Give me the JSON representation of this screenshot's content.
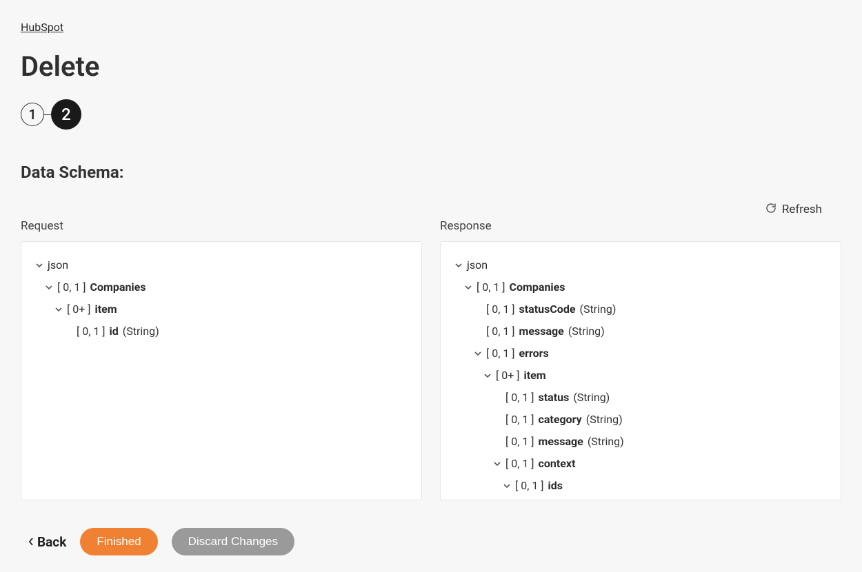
{
  "breadcrumb": "HubSpot",
  "title": "Delete",
  "stepper": {
    "step1": "1",
    "step2": "2"
  },
  "section_title": "Data Schema:",
  "refresh_label": "Refresh",
  "request_label": "Request",
  "response_label": "Response",
  "request_tree": {
    "root": "json",
    "n1_card": "[ 0, 1 ]",
    "n1_name": "Companies",
    "n2_card": "[ 0+ ]",
    "n2_name": "item",
    "n3_card": "[ 0, 1 ]",
    "n3_name": "id",
    "n3_type": "(String)"
  },
  "response_tree": {
    "root": "json",
    "n1_card": "[ 0, 1 ]",
    "n1_name": "Companies",
    "n2_card": "[ 0, 1 ]",
    "n2_name": "statusCode",
    "n2_type": "(String)",
    "n3_card": "[ 0, 1 ]",
    "n3_name": "message",
    "n3_type": "(String)",
    "n4_card": "[ 0, 1 ]",
    "n4_name": "errors",
    "n5_card": "[ 0+ ]",
    "n5_name": "item",
    "n6_card": "[ 0, 1 ]",
    "n6_name": "status",
    "n6_type": "(String)",
    "n7_card": "[ 0, 1 ]",
    "n7_name": "category",
    "n7_type": "(String)",
    "n8_card": "[ 0, 1 ]",
    "n8_name": "message",
    "n8_type": "(String)",
    "n9_card": "[ 0, 1 ]",
    "n9_name": "context",
    "n10_card": "[ 0, 1 ]",
    "n10_name": "ids"
  },
  "footer": {
    "back": "Back",
    "finished": "Finished",
    "discard": "Discard Changes"
  }
}
